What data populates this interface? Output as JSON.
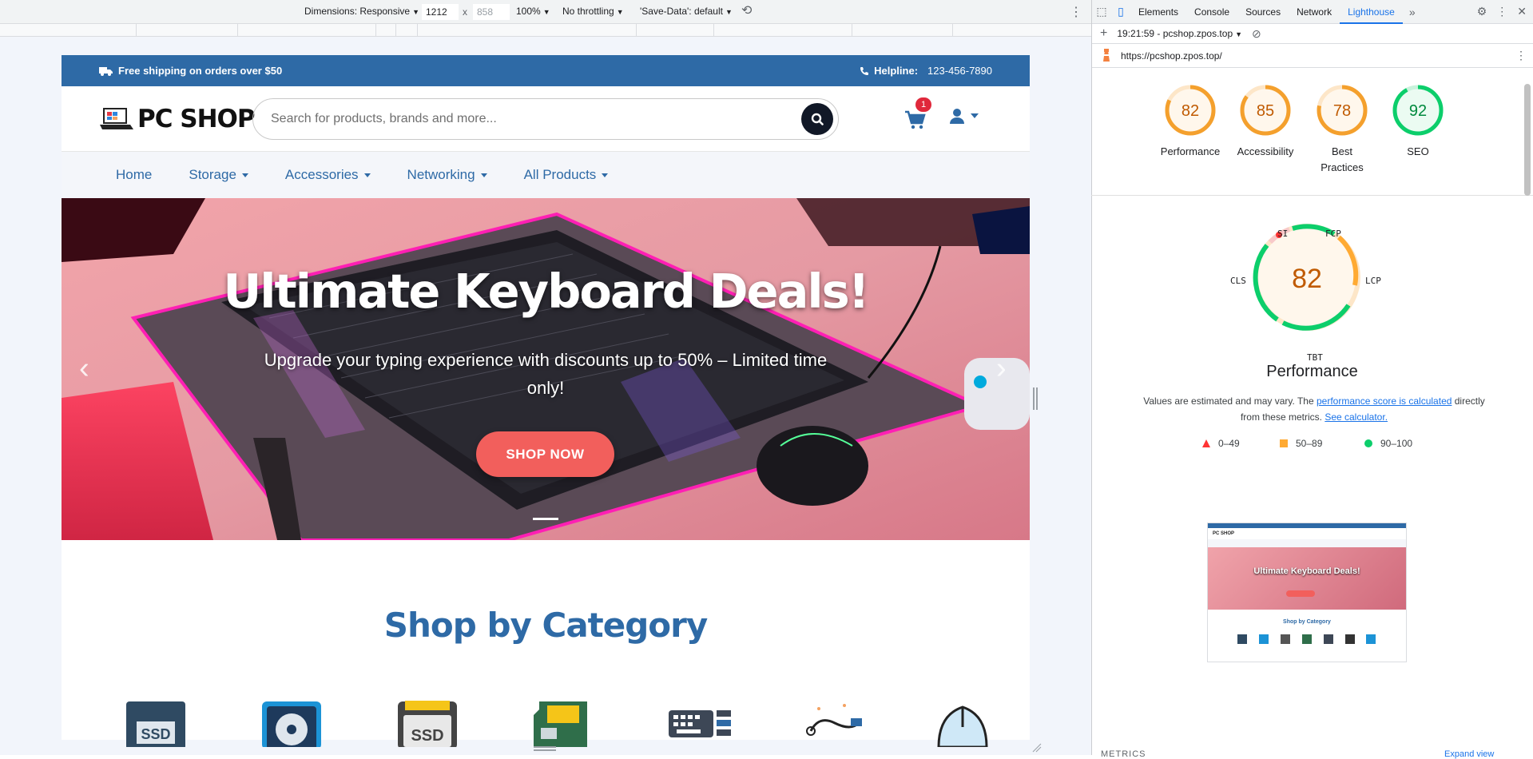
{
  "device_toolbar": {
    "dimensions_label": "Dimensions: Responsive",
    "width": "1212",
    "times": "x",
    "height": "858",
    "zoom": "100%",
    "throttling": "No throttling",
    "save_data": "'Save-Data': default"
  },
  "site": {
    "shipping_text": "Free shipping on orders over $50",
    "helpline_label": "Helpline:",
    "helpline_number": "123-456-7890",
    "logo_text": "PC SHOP",
    "search_placeholder": "Search for products, brands and more...",
    "cart_count": "1",
    "nav": [
      "Home",
      "Storage",
      "Accessories",
      "Networking",
      "All Products"
    ],
    "hero": {
      "title": "Ultimate Keyboard Deals!",
      "subtitle": "Upgrade your typing experience with discounts up to 50% – Limited time only!",
      "button": "SHOP NOW"
    },
    "section_title": "Shop by Category",
    "categories": [
      "ssd-icon",
      "hdd-icon",
      "ssd-chip-icon",
      "memory-card-icon",
      "keyboard-icon",
      "cable-icon",
      "mouse-icon"
    ]
  },
  "devtools": {
    "tabs": [
      "Elements",
      "Console",
      "Sources",
      "Network",
      "Lighthouse"
    ],
    "active_tab": "Lighthouse",
    "report_selector": "19:21:59 - pcshop.zpos.top",
    "url": "https://pcshop.zpos.top/",
    "scores": [
      {
        "value": "82",
        "label": "Performance",
        "color": "#f4a02d"
      },
      {
        "value": "85",
        "label": "Accessibility",
        "color": "#f4a02d"
      },
      {
        "value": "78",
        "label": "Best Practices",
        "color": "#f4a02d"
      },
      {
        "value": "92",
        "label": "SEO",
        "color": "#0cce6b"
      }
    ],
    "perf_gauge": {
      "value": "82",
      "metrics": {
        "si": "SI",
        "fcp": "FCP",
        "lcp": "LCP",
        "tbt": "TBT",
        "cls": "CLS"
      },
      "title": "Performance"
    },
    "note": {
      "before": "Values are estimated and may vary. The ",
      "link1": "performance score is calculated",
      "middle": " directly from these metrics. ",
      "link2": "See calculator."
    },
    "legend": [
      {
        "range": "0–49",
        "color": "#ff3333"
      },
      {
        "range": "50–89",
        "color": "#ffaa33"
      },
      {
        "range": "90–100",
        "color": "#0cce6b"
      }
    ],
    "thumb": {
      "title": "Ultimate Keyboard Deals!",
      "section": "Shop by Category",
      "logo": "PC SHOP"
    },
    "metrics_heading": "METRICS",
    "expand_view": "Expand view"
  }
}
